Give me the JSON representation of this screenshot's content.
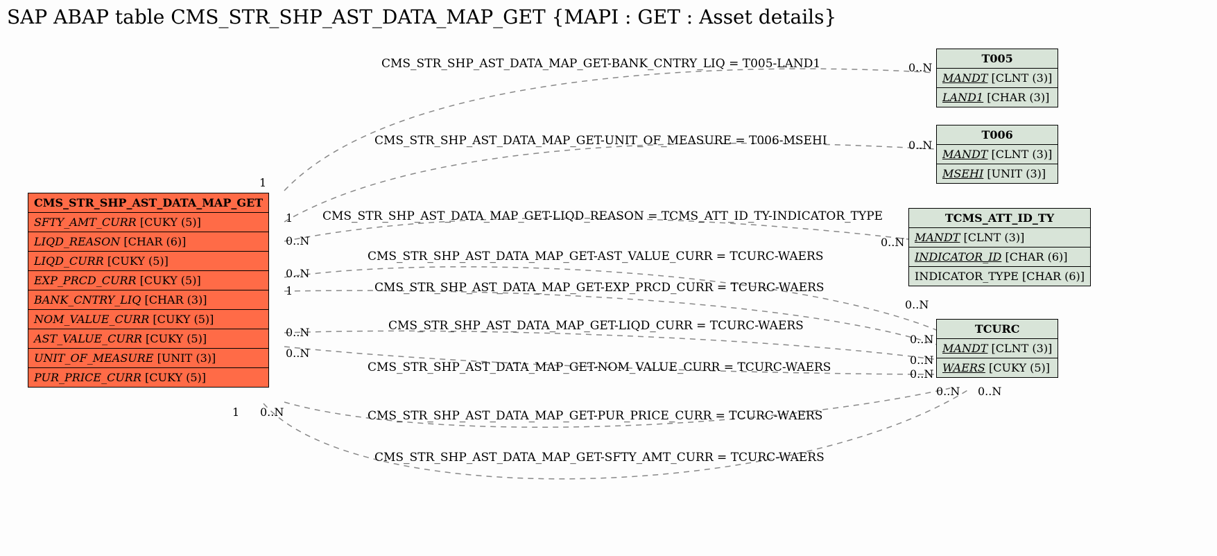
{
  "title": "SAP ABAP table CMS_STR_SHP_AST_DATA_MAP_GET {MAPI : GET : Asset details}",
  "main": {
    "name": "CMS_STR_SHP_AST_DATA_MAP_GET",
    "fields": [
      {
        "name": "SFTY_AMT_CURR",
        "type": "[CUKY (5)]"
      },
      {
        "name": "LIQD_REASON",
        "type": "[CHAR (6)]"
      },
      {
        "name": "LIQD_CURR",
        "type": "[CUKY (5)]"
      },
      {
        "name": "EXP_PRCD_CURR",
        "type": "[CUKY (5)]"
      },
      {
        "name": "BANK_CNTRY_LIQ",
        "type": "[CHAR (3)]"
      },
      {
        "name": "NOM_VALUE_CURR",
        "type": "[CUKY (5)]"
      },
      {
        "name": "AST_VALUE_CURR",
        "type": "[CUKY (5)]"
      },
      {
        "name": "UNIT_OF_MEASURE",
        "type": "[UNIT (3)]"
      },
      {
        "name": "PUR_PRICE_CURR",
        "type": "[CUKY (5)]"
      }
    ]
  },
  "refs": {
    "t005": {
      "name": "T005",
      "rows": [
        {
          "key": true,
          "name": "MANDT",
          "type": "[CLNT (3)]"
        },
        {
          "key": true,
          "name": "LAND1",
          "type": "[CHAR (3)]"
        }
      ]
    },
    "t006": {
      "name": "T006",
      "rows": [
        {
          "key": true,
          "name": "MANDT",
          "type": "[CLNT (3)]"
        },
        {
          "key": true,
          "name": "MSEHI",
          "type": "[UNIT (3)]"
        }
      ]
    },
    "tcms": {
      "name": "TCMS_ATT_ID_TY",
      "rows": [
        {
          "key": true,
          "name": "MANDT",
          "type": "[CLNT (3)]"
        },
        {
          "key": true,
          "name": "INDICATOR_ID",
          "type": "[CHAR (6)]"
        },
        {
          "key": false,
          "name": "INDICATOR_TYPE",
          "type": "[CHAR (6)]"
        }
      ]
    },
    "tcurc": {
      "name": "TCURC",
      "rows": [
        {
          "key": true,
          "name": "MANDT",
          "type": "[CLNT (3)]"
        },
        {
          "key": true,
          "name": "WAERS",
          "type": "[CUKY (5)]"
        }
      ]
    }
  },
  "rels": {
    "r1": "CMS_STR_SHP_AST_DATA_MAP_GET-BANK_CNTRY_LIQ = T005-LAND1",
    "r2": "CMS_STR_SHP_AST_DATA_MAP_GET-UNIT_OF_MEASURE = T006-MSEHI",
    "r3": "CMS_STR_SHP_AST_DATA_MAP_GET-LIQD_REASON = TCMS_ATT_ID_TY-INDICATOR_TYPE",
    "r4": "CMS_STR_SHP_AST_DATA_MAP_GET-AST_VALUE_CURR = TCURC-WAERS",
    "r5": "CMS_STR_SHP_AST_DATA_MAP_GET-EXP_PRCD_CURR = TCURC-WAERS",
    "r6": "CMS_STR_SHP_AST_DATA_MAP_GET-LIQD_CURR = TCURC-WAERS",
    "r7": "CMS_STR_SHP_AST_DATA_MAP_GET-NOM_VALUE_CURR = TCURC-WAERS",
    "r8": "CMS_STR_SHP_AST_DATA_MAP_GET-PUR_PRICE_CURR = TCURC-WAERS",
    "r9": "CMS_STR_SHP_AST_DATA_MAP_GET-SFTY_AMT_CURR = TCURC-WAERS"
  },
  "cards": {
    "one": "1",
    "zeroN": "0..N"
  }
}
